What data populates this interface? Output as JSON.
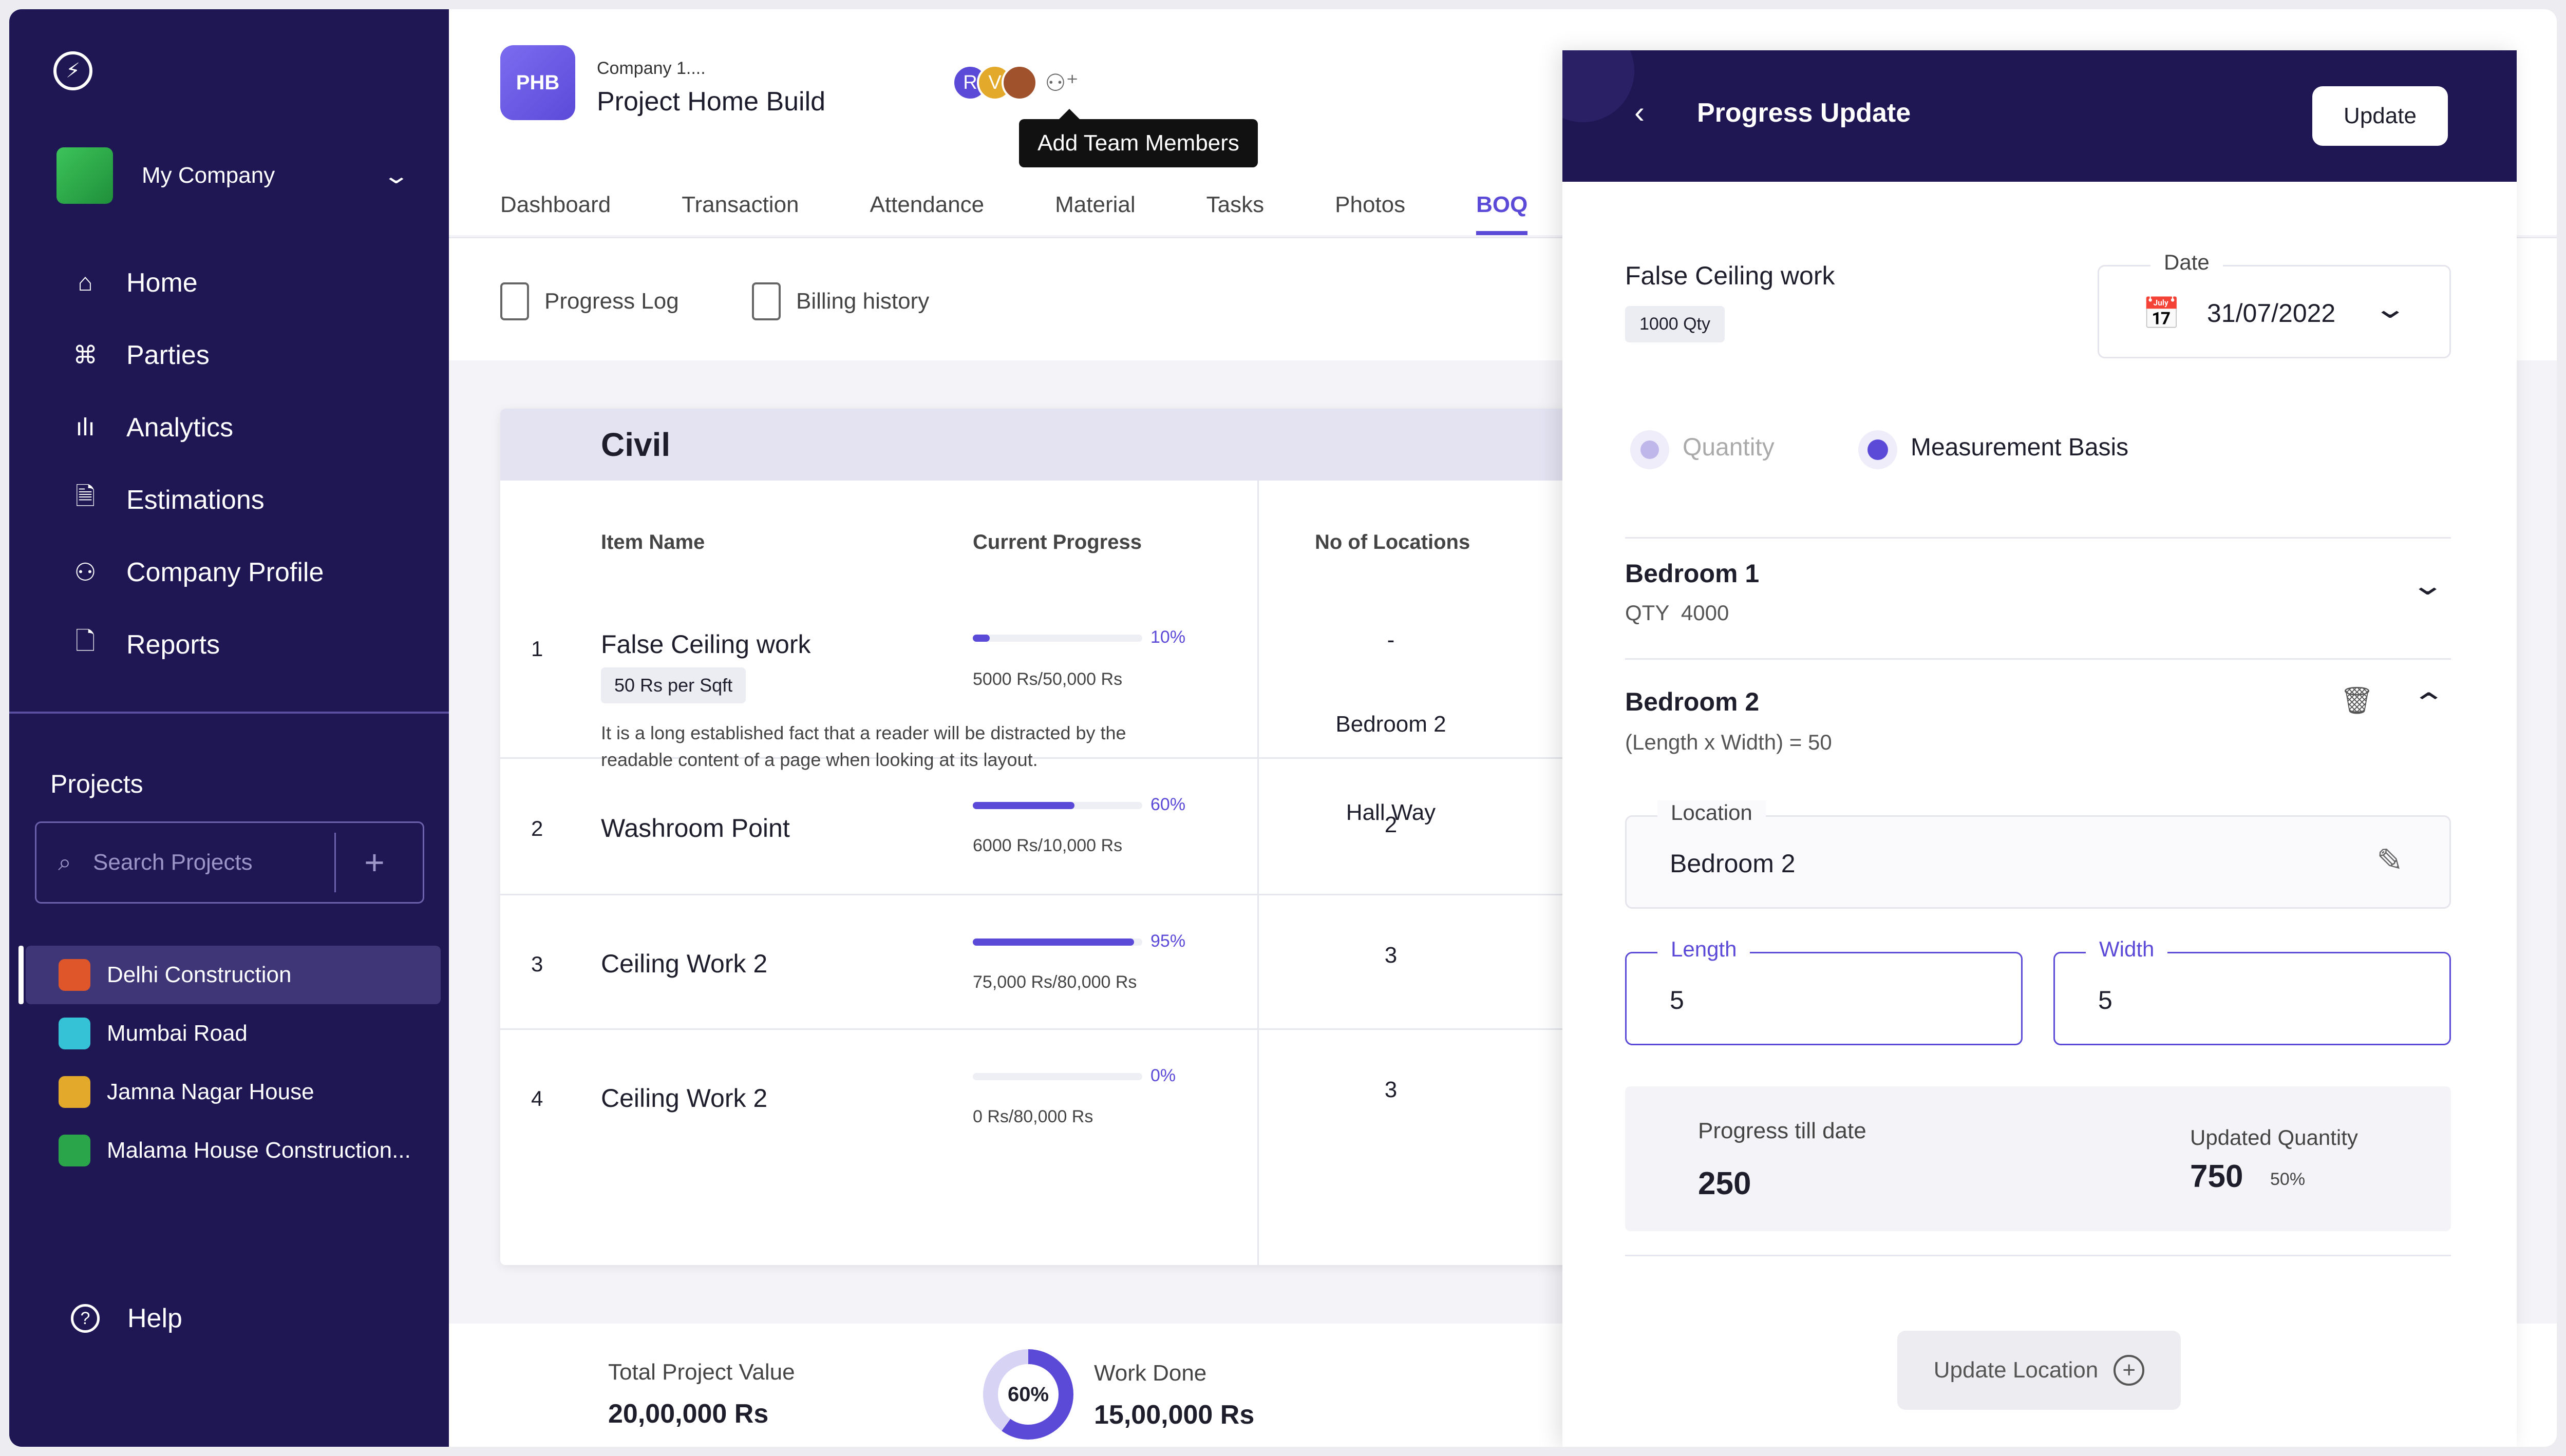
{
  "sidebar": {
    "company": "My Company",
    "nav": [
      {
        "label": "Home",
        "icon": "home-icon"
      },
      {
        "label": "Parties",
        "icon": "command-icon"
      },
      {
        "label": "Analytics",
        "icon": "bar-chart-icon"
      },
      {
        "label": "Estimations",
        "icon": "document-icon"
      },
      {
        "label": "Company Profile",
        "icon": "user-icon"
      },
      {
        "label": "Reports",
        "icon": "file-icon"
      }
    ],
    "projects_title": "Projects",
    "search_placeholder": "Search Projects",
    "projects": [
      {
        "label": "Delhi Construction",
        "color": "#e0562b"
      },
      {
        "label": "Mumbai Road",
        "color": "#35c2d6"
      },
      {
        "label": "Jamna Nagar House",
        "color": "#e3a92a"
      },
      {
        "label": "Malama House Construction...",
        "color": "#2aa54a"
      }
    ],
    "help": "Help"
  },
  "header": {
    "badge": "PHB",
    "company": "Company 1....",
    "title": "Project Home Build",
    "avatar_initials": [
      "R",
      "V"
    ],
    "tooltip": "Add Team Members",
    "tabs": [
      "Dashboard",
      "Transaction",
      "Attendance",
      "Material",
      "Tasks",
      "Photos",
      "BOQ"
    ]
  },
  "subtabs": [
    "Progress Log",
    "Billing history"
  ],
  "table": {
    "section": "Civil",
    "col_item": "Item Name",
    "col_progress": "Current Progress",
    "col_locations": "No of Locations",
    "rows": [
      {
        "num": "1",
        "name": "False Ceiling work",
        "tag": "50 Rs per Sqft",
        "desc": "It is a long established fact that a reader will be distracted by the readable content of a page when looking at its layout.",
        "progress": 10,
        "pct": "10%",
        "amount": "5000 Rs/50,000 Rs",
        "loc1": "-",
        "loc2": "Bedroom 2",
        "loc3": "Hall Way"
      },
      {
        "num": "2",
        "name": "Washroom Point",
        "progress": 60,
        "pct": "60%",
        "amount": "6000 Rs/10,000 Rs",
        "locations": "2"
      },
      {
        "num": "3",
        "name": "Ceiling Work 2",
        "progress": 95,
        "pct": "95%",
        "amount": "75,000 Rs/80,000 Rs",
        "locations": "3"
      },
      {
        "num": "4",
        "name": "Ceiling Work 2",
        "progress": 0,
        "pct": "0%",
        "amount": "0 Rs/80,000 Rs",
        "locations": "3"
      }
    ]
  },
  "footer": {
    "total_label": "Total Project Value",
    "total_value": "20,00,000 Rs",
    "donut_pct": "60%",
    "work_done_label": "Work Done",
    "work_done_value": "15,00,000 Rs"
  },
  "panel": {
    "title": "Progress Update",
    "update_button": "Update",
    "item_name": "False Ceiling work",
    "qty_tag": "1000 Qty",
    "date_label": "Date",
    "date_value": "31/07/2022",
    "radio_quantity": "Quantity",
    "radio_measurement": "Measurement Basis",
    "bedroom1_title": "Bedroom 1",
    "bedroom1_qty": "QTY  4000",
    "bedroom2_title": "Bedroom 2",
    "bedroom2_formula": "(Length x Width) = 50",
    "location_label": "Location",
    "location_value": "Bedroom 2",
    "length_label": "Length",
    "length_value": "5",
    "width_label": "Width",
    "width_value": "5",
    "progress_label": "Progress till date",
    "progress_value": "250",
    "updated_label": "Updated Quantity",
    "updated_value": "750",
    "updated_pct": "50%",
    "update_location": "Update Location"
  }
}
